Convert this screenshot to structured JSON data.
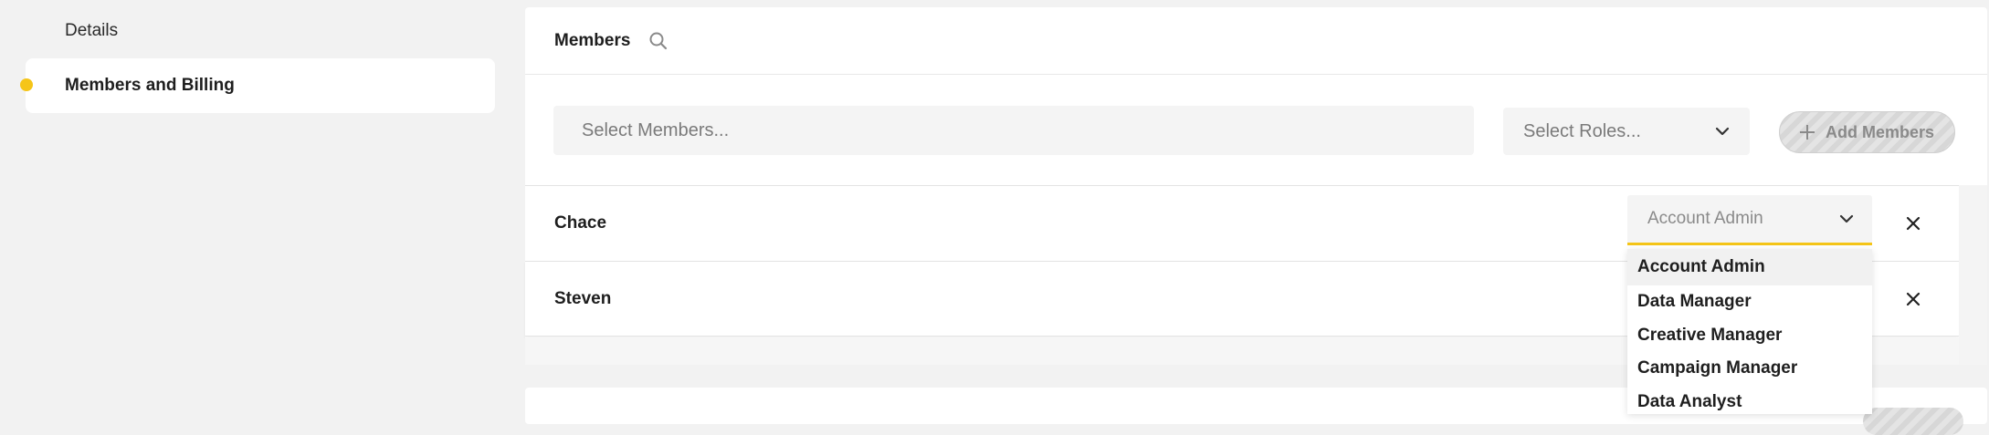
{
  "sidebar": {
    "items": [
      {
        "label": "Details"
      },
      {
        "label": "Members and Billing"
      }
    ]
  },
  "members_card": {
    "title": "Members",
    "select_members_placeholder": "Select Members...",
    "select_roles_placeholder": "Select Roles...",
    "add_members_label": "Add Members",
    "rows": [
      {
        "name": "Chace",
        "role": "Account Admin"
      },
      {
        "name": "Steven",
        "role": ""
      }
    ]
  },
  "role_dropdown": {
    "options": [
      "Account Admin",
      "Data Manager",
      "Creative Manager",
      "Campaign Manager",
      "Data Analyst"
    ],
    "selected": "Account Admin"
  },
  "colors": {
    "accent": "#f5c518",
    "background": "#f2f2f2"
  },
  "icons": [
    "search-icon",
    "chevron-down-icon",
    "plus-icon",
    "close-icon"
  ]
}
